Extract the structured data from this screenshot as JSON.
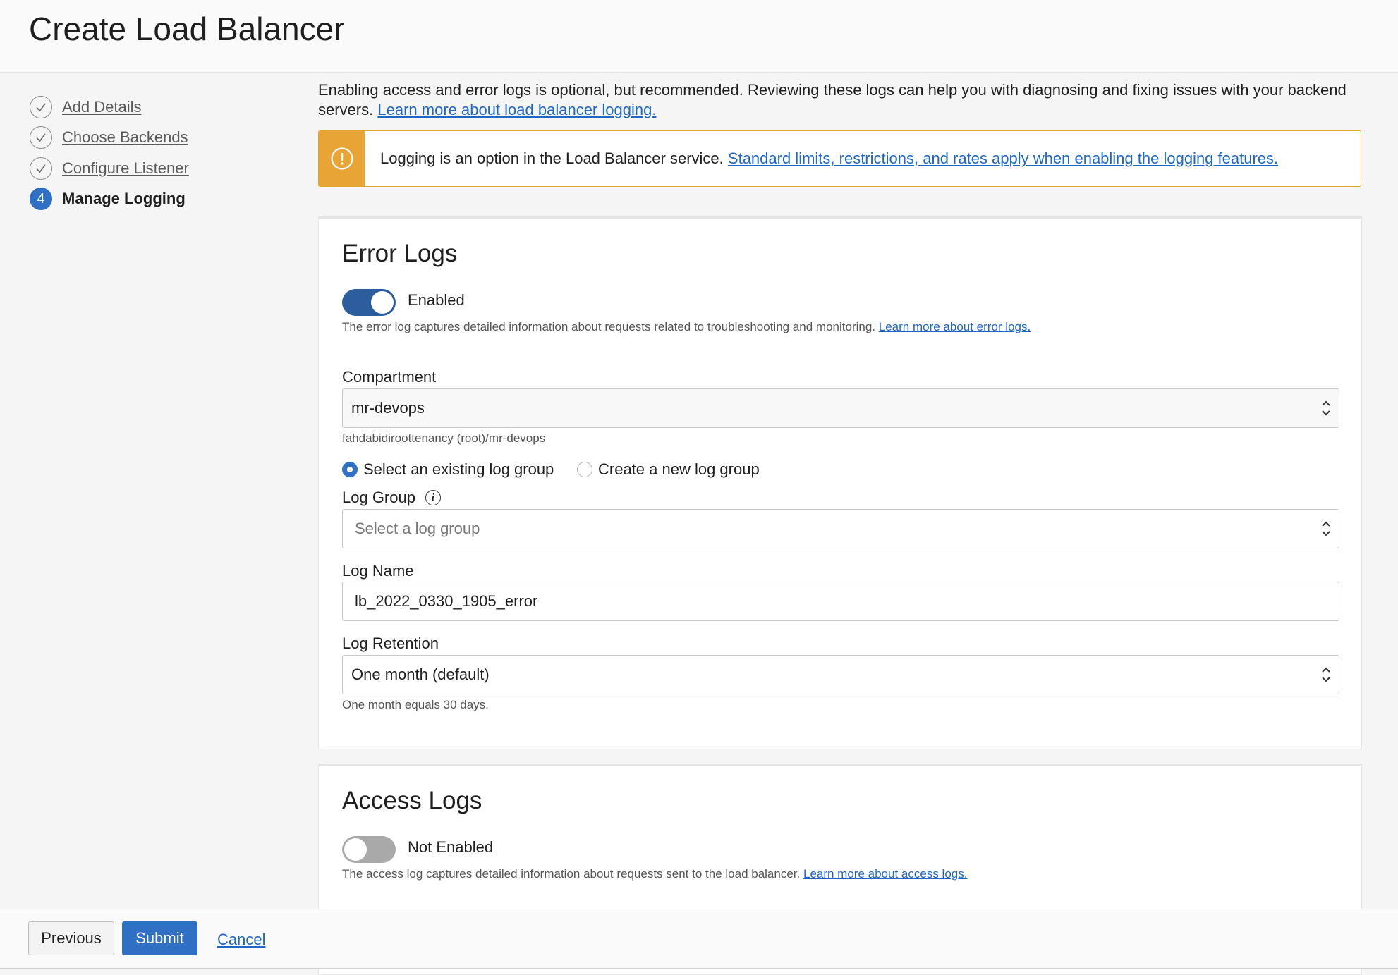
{
  "header": {
    "title": "Create Load Balancer"
  },
  "steps": [
    {
      "label": "Add Details",
      "state": "complete"
    },
    {
      "label": "Choose Backends",
      "state": "complete"
    },
    {
      "label": "Configure Listener",
      "state": "complete"
    },
    {
      "number": "4",
      "label": "Manage Logging",
      "state": "active"
    }
  ],
  "intro": {
    "text": "Enabling access and error logs is optional, but recommended. Reviewing these logs can help you with diagnosing and fixing issues with your backend servers.",
    "link": "Learn more about load balancer logging."
  },
  "alert": {
    "text": "Logging is an option in the Load Balancer service.",
    "link": "Standard limits, restrictions, and rates apply when enabling the logging features.",
    "icon": "warning-icon",
    "color": "#e9a436"
  },
  "error_logs": {
    "title": "Error Logs",
    "toggle_state": "Enabled",
    "description": "The error log captures detailed information about requests related to troubleshooting and monitoring.",
    "description_link": "Learn more about error logs.",
    "compartment_label": "Compartment",
    "compartment_value": "mr-devops",
    "compartment_path": "fahdabidiroottenancy (root)/mr-devops",
    "radio_existing": "Select an existing log group",
    "radio_new": "Create a new log group",
    "log_group_label": "Log Group",
    "log_group_placeholder": "Select a log group",
    "log_name_label": "Log Name",
    "log_name_value": "lb_2022_0330_1905_error",
    "retention_label": "Log Retention",
    "retention_value": "One month (default)",
    "retention_help": "One month equals 30 days."
  },
  "access_logs": {
    "title": "Access Logs",
    "toggle_state": "Not Enabled",
    "description": "The access log captures detailed information about requests sent to the load balancer.",
    "description_link": "Learn more about access logs."
  },
  "footer": {
    "previous": "Previous",
    "submit": "Submit",
    "cancel": "Cancel"
  },
  "colors": {
    "primary": "#2f6fc4",
    "toggle_on": "#2c5e9e",
    "warning": "#e9a436"
  }
}
